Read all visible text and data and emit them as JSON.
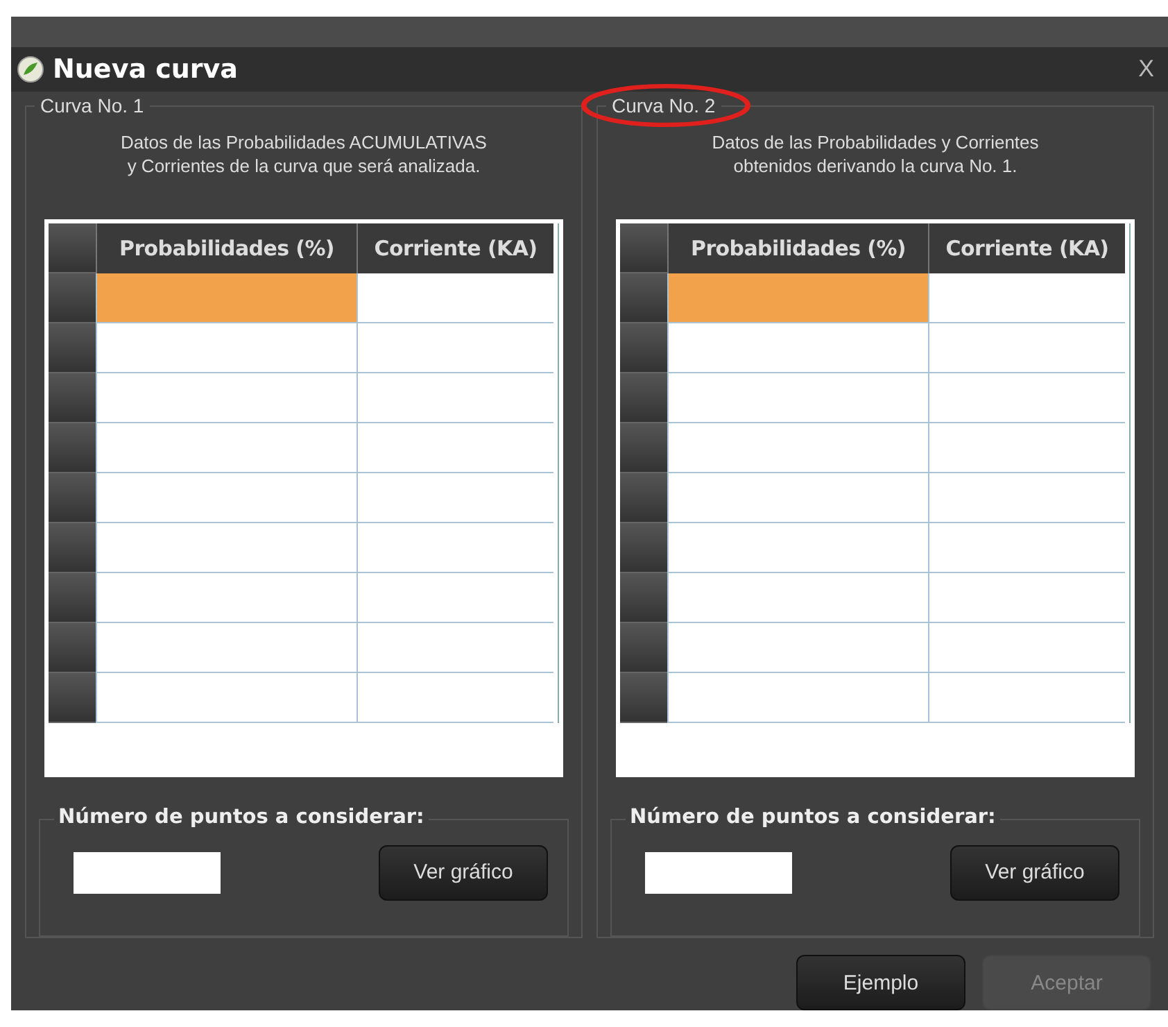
{
  "window": {
    "title": "Nueva curva",
    "close": "X"
  },
  "panels": [
    {
      "legend": "Curva No. 1",
      "legend_circled": false,
      "description": [
        "Datos de las Probabilidades ACUMULATIVAS",
        "y Corrientes de la curva  que será analizada."
      ],
      "columns": [
        "Probabilidades (%)",
        "Corriente (KA)"
      ],
      "rows": [
        {
          "cells": [
            {
              "selected": true
            },
            {
              "selected": false
            }
          ]
        },
        {
          "cells": [
            {
              "selected": false
            },
            {
              "selected": false
            }
          ]
        },
        {
          "cells": [
            {
              "selected": false
            },
            {
              "selected": false
            }
          ]
        },
        {
          "cells": [
            {
              "selected": false
            },
            {
              "selected": false
            }
          ]
        },
        {
          "cells": [
            {
              "selected": false
            },
            {
              "selected": false
            }
          ]
        },
        {
          "cells": [
            {
              "selected": false
            },
            {
              "selected": false
            }
          ]
        },
        {
          "cells": [
            {
              "selected": false
            },
            {
              "selected": false
            }
          ]
        },
        {
          "cells": [
            {
              "selected": false
            },
            {
              "selected": false
            }
          ]
        },
        {
          "cells": [
            {
              "selected": false
            },
            {
              "selected": false
            }
          ]
        }
      ],
      "points_label": "Número de puntos a considerar:",
      "button": "Ver gráfico"
    },
    {
      "legend": "Curva No. 2",
      "legend_circled": true,
      "description": [
        "Datos de las Probabilidades y Corrientes",
        "obtenidos derivando la curva  No. 1."
      ],
      "columns": [
        "Probabilidades (%)",
        "Corriente (KA)"
      ],
      "rows": [
        {
          "cells": [
            {
              "selected": true
            },
            {
              "selected": false
            }
          ]
        },
        {
          "cells": [
            {
              "selected": false
            },
            {
              "selected": false
            }
          ]
        },
        {
          "cells": [
            {
              "selected": false
            },
            {
              "selected": false
            }
          ]
        },
        {
          "cells": [
            {
              "selected": false
            },
            {
              "selected": false
            }
          ]
        },
        {
          "cells": [
            {
              "selected": false
            },
            {
              "selected": false
            }
          ]
        },
        {
          "cells": [
            {
              "selected": false
            },
            {
              "selected": false
            }
          ]
        },
        {
          "cells": [
            {
              "selected": false
            },
            {
              "selected": false
            }
          ]
        },
        {
          "cells": [
            {
              "selected": false
            },
            {
              "selected": false
            }
          ]
        },
        {
          "cells": [
            {
              "selected": false
            },
            {
              "selected": false
            }
          ]
        }
      ],
      "points_label": "Número de puntos a considerar:",
      "button": "Ver gráfico"
    }
  ],
  "buttons": [
    {
      "label": "Ejemplo",
      "disabled": false
    },
    {
      "label": "Aceptar",
      "disabled": true
    }
  ]
}
